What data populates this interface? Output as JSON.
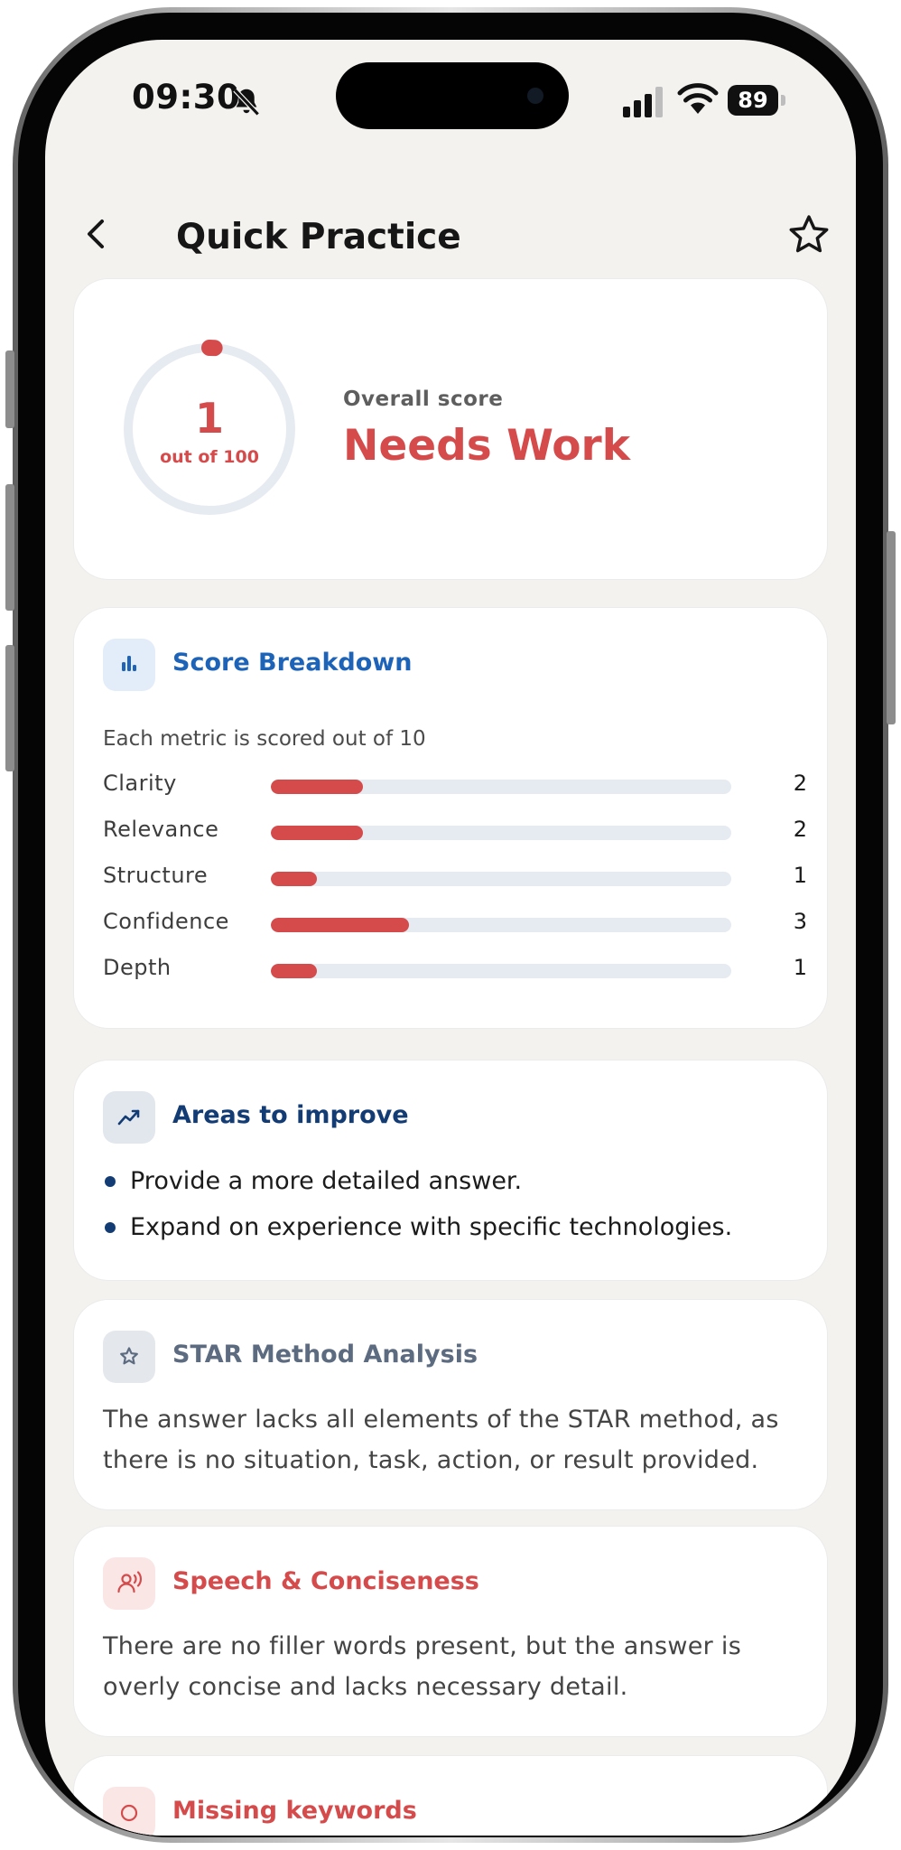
{
  "status_bar": {
    "time": "09:30",
    "battery": "89"
  },
  "nav": {
    "title": "Quick Practice"
  },
  "score": {
    "value": "1",
    "max_label": "out of 100",
    "value_fraction": 0.01,
    "label": "Overall score",
    "rating": "Needs Work"
  },
  "breakdown": {
    "title": "Score Breakdown",
    "subtitle": "Each metric is scored out of 10",
    "metrics": [
      {
        "label": "Clarity",
        "value": "2",
        "fraction": 0.2
      },
      {
        "label": "Relevance",
        "value": "2",
        "fraction": 0.2
      },
      {
        "label": "Structure",
        "value": "1",
        "fraction": 0.1
      },
      {
        "label": "Confidence",
        "value": "3",
        "fraction": 0.3
      },
      {
        "label": "Depth",
        "value": "1",
        "fraction": 0.1
      }
    ]
  },
  "improve": {
    "title": "Areas to improve",
    "items": [
      "Provide a more detailed answer.",
      "Expand on experience with specific technologies."
    ]
  },
  "star": {
    "title": "STAR Method Analysis",
    "text": "The answer lacks all elements of the STAR method, as there is no situation, task, action, or result provided."
  },
  "speech": {
    "title": "Speech & Conciseness",
    "text": "There are no filler words present, but the answer is overly concise and lacks necessary detail."
  },
  "missing": {
    "title": "Missing keywords"
  },
  "colors": {
    "accent_red": "#d54b4b",
    "breakdown_blue": "#1d63b8",
    "improve_navy": "#123c73",
    "star_slate": "#5c6b80",
    "track": "#e6ebf2",
    "background": "#f3f2ef"
  }
}
